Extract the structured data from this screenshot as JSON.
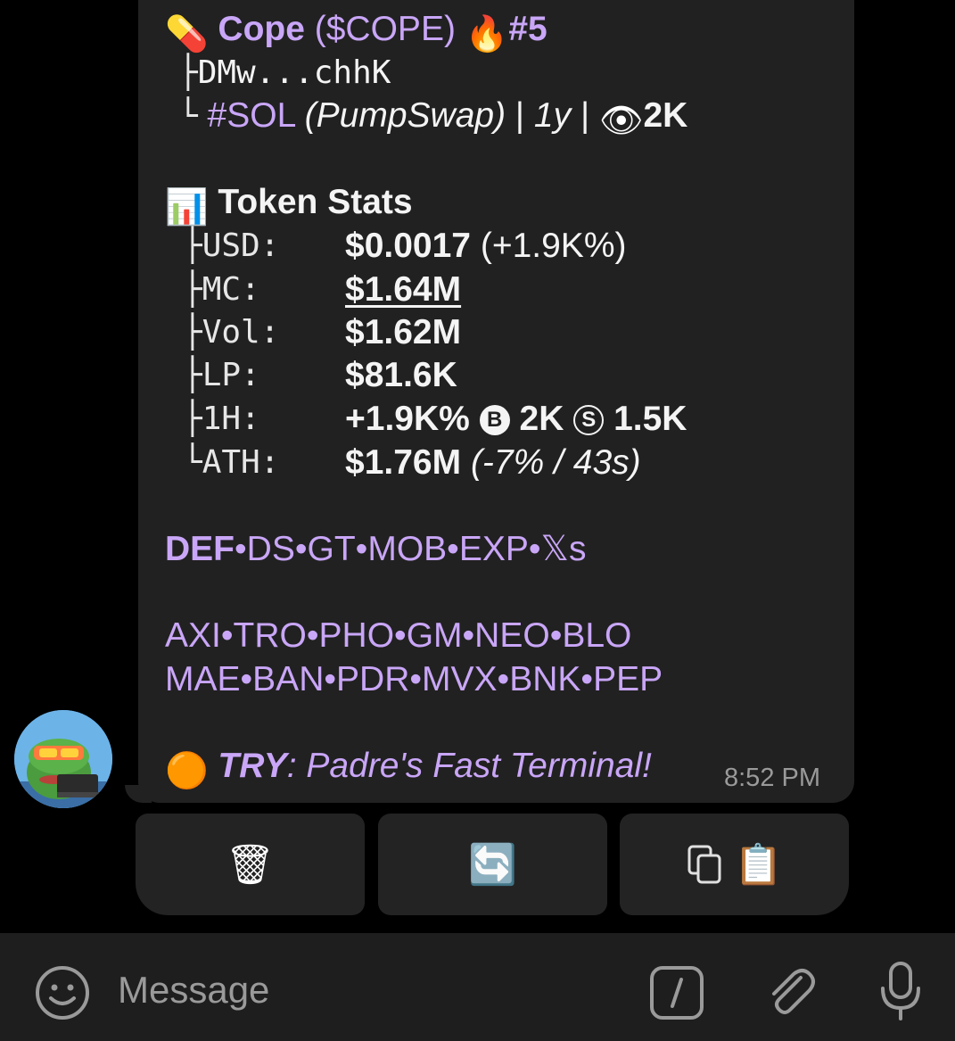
{
  "header": {
    "pill_emoji": "💊",
    "token_name": "Cope",
    "token_ticker": "($COPE)",
    "fire_emoji": "🔥",
    "rank": "#5",
    "tree_branch": "├",
    "tree_end": "└",
    "address": "DMw...chhK",
    "chain": "#SOL",
    "dex": "(PumpSwap)",
    "sep": "|",
    "age": "1y",
    "eye_emoji": "👁",
    "views": "2K"
  },
  "stats": {
    "chart_emoji": "📊",
    "title": "Token Stats",
    "rows": [
      {
        "prefix": "├",
        "key": "USD:",
        "value": "$0.0017",
        "extra": "(+1.9K%)"
      },
      {
        "prefix": "├",
        "key": "MC:",
        "value": "$1.64M",
        "extra": ""
      },
      {
        "prefix": "├",
        "key": "Vol:",
        "value": "$1.62M",
        "extra": ""
      },
      {
        "prefix": "├",
        "key": "LP:",
        "value": "$81.6K",
        "extra": ""
      },
      {
        "prefix": "├",
        "key": "1H:",
        "value": "+1.9K%",
        "extra": ""
      },
      {
        "prefix": "└",
        "key": "ATH:",
        "value": "$1.76M",
        "extra": "(-7% / 43s)"
      }
    ],
    "buys_badge": "B",
    "buys": "2K",
    "sells_badge": "S",
    "sells": "1.5K"
  },
  "links": {
    "sep": "•",
    "row1": [
      "DEF",
      "DS",
      "GT",
      "MOB",
      "EXP",
      "𝕏s"
    ],
    "row2": [
      "AXI",
      "TRO",
      "PHO",
      "GM",
      "NEO",
      "BLO"
    ],
    "row3": [
      "MAE",
      "BAN",
      "PDR",
      "MVX",
      "BNK",
      "PEP"
    ]
  },
  "promo": {
    "emoji": "🟠",
    "label": "TRY",
    "colon": ":",
    "text": "Padre's Fast Terminal!"
  },
  "message_time": "8:52 PM",
  "buttons": {
    "delete_icon": "🗑",
    "refresh_icon": "🔄",
    "copy_icon": "📋"
  },
  "composer": {
    "placeholder": "Message"
  },
  "colors": {
    "accent": "#c9a6f7",
    "bubble": "#212121",
    "background": "#000000"
  }
}
